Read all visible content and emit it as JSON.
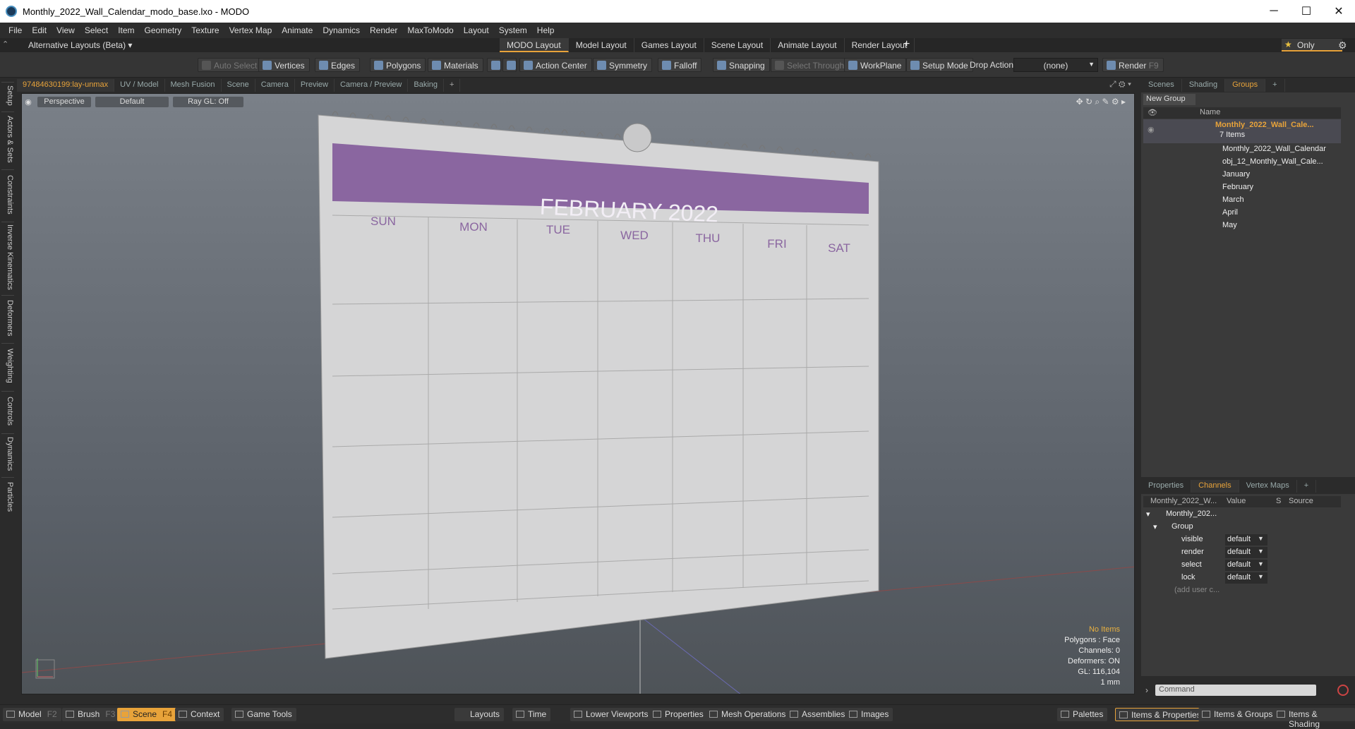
{
  "window": {
    "title": "Monthly_2022_Wall_Calendar_modo_base.lxo - MODO"
  },
  "menu": [
    "File",
    "Edit",
    "View",
    "Select",
    "Item",
    "Geometry",
    "Texture",
    "Vertex Map",
    "Animate",
    "Dynamics",
    "Render",
    "MaxToModo",
    "Layout",
    "System",
    "Help"
  ],
  "layout_bar": {
    "alt_layouts": "Alternative Layouts (Beta) ▾",
    "tabs": [
      "MODO Layout",
      "Model Layout",
      "Games Layout",
      "Scene Layout",
      "Animate Layout",
      "Render Layout"
    ],
    "only_label": "Only"
  },
  "toolbar": {
    "auto_select": "Auto Select",
    "vertices": "Vertices",
    "edges": "Edges",
    "polygons": "Polygons",
    "materials": "Materials",
    "action_center": "Action Center",
    "symmetry": "Symmetry",
    "falloff": "Falloff",
    "snapping": "Snapping",
    "select_through": "Select Through",
    "workplane": "WorkPlane",
    "setup_mode": "Setup Mode",
    "drop_action": "Drop Action",
    "drop_action_value": "(none)",
    "render": "Render",
    "render_key": "F9"
  },
  "left_tabs": [
    "Setup",
    "Actors & Sets",
    "Constraints",
    "Inverse Kinematics",
    "Deformers",
    "Weighting",
    "Controls",
    "Dynamics",
    "Particles"
  ],
  "viewport_tabs": [
    "97484630199:lay-unmax",
    "UV / Model",
    "Mesh Fusion",
    "Scene",
    "Camera",
    "Preview",
    "Camera / Preview",
    "Baking"
  ],
  "viewport": {
    "perspective": "Perspective",
    "default": "Default",
    "raygl": "Ray GL: Off",
    "hud": {
      "items": "No Items",
      "polygons": "Polygons : Face",
      "channels": "Channels: 0",
      "deformers": "Deformers: ON",
      "gl": "GL: 116,104",
      "unit": "1 mm"
    }
  },
  "calendar": {
    "title": "FEBRUARY 2022",
    "days": [
      "SUN",
      "MON",
      "TUE",
      "WED",
      "THU",
      "FRI",
      "SAT"
    ],
    "accent": "#8a66a0"
  },
  "right_panel": {
    "tabs": [
      "Scenes",
      "Shading",
      "Groups"
    ],
    "new_group": "New Group",
    "name_header": "Name",
    "group_name": "Monthly_2022_Wall_Cale...",
    "group_count": "7 Items",
    "items": [
      "Monthly_2022_Wall_Calendar",
      "obj_12_Monthly_Wall_Cale...",
      "January",
      "February",
      "March",
      "April",
      "May"
    ]
  },
  "channels_panel": {
    "tabs": [
      "Properties",
      "Channels",
      "Vertex Maps"
    ],
    "col_name": "Monthly_2022_W...",
    "col_value": "Value",
    "col_s": "S",
    "col_source": "Source",
    "root": "Monthly_202...",
    "group": "Group",
    "rows": [
      {
        "name": "visible",
        "value": "default"
      },
      {
        "name": "render",
        "value": "default"
      },
      {
        "name": "select",
        "value": "default"
      },
      {
        "name": "lock",
        "value": "default"
      }
    ],
    "add_user": "(add user c..."
  },
  "command": {
    "placeholder": "Command"
  },
  "bottom_bar": {
    "model": "Model",
    "model_key": "F2",
    "brush": "Brush",
    "brush_key": "F3",
    "scene": "Scene",
    "scene_key": "F4",
    "context": "Context",
    "game_tools": "Game Tools",
    "layouts": "Layouts",
    "time": "Time",
    "lower_viewports": "Lower Viewports",
    "properties": "Properties",
    "mesh_operations": "Mesh Operations",
    "assemblies": "Assemblies",
    "images": "Images",
    "palettes": "Palettes",
    "items_properties": "Items & Properties",
    "items_groups": "Items & Groups",
    "items_shading": "Items & Shading"
  }
}
